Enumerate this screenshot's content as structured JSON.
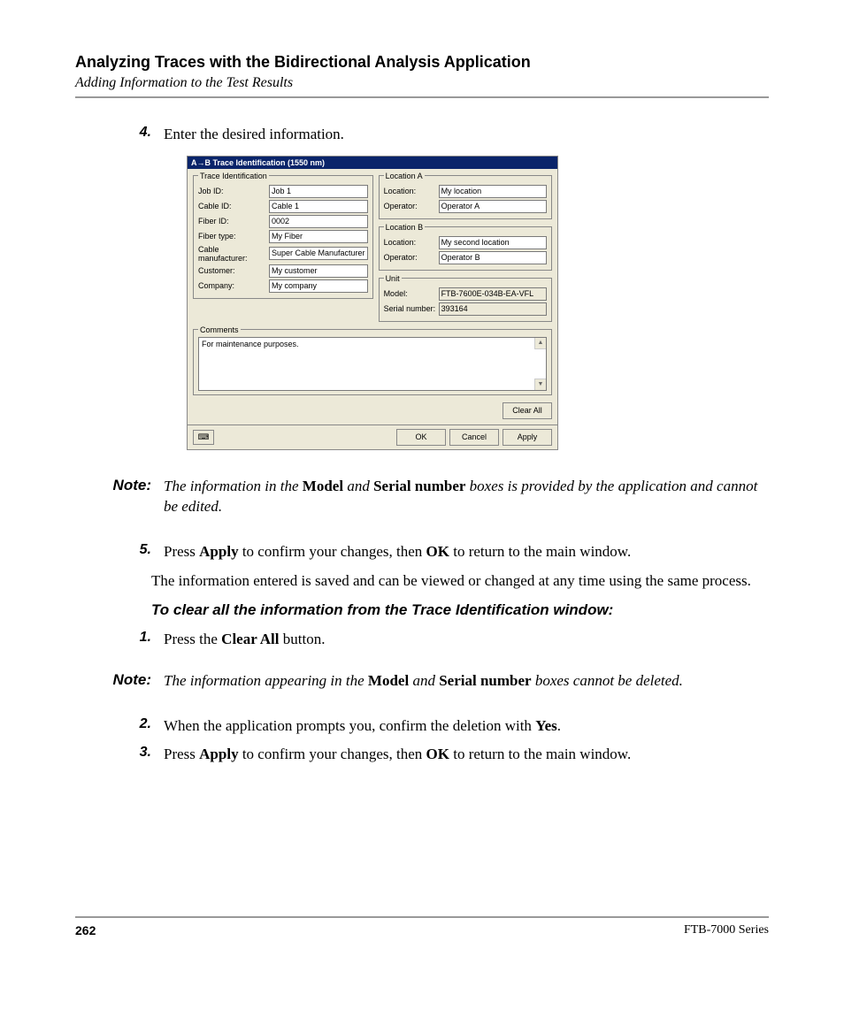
{
  "header": {
    "chapter_title": "Analyzing Traces with the Bidirectional Analysis Application",
    "chapter_sub": "Adding Information to the Test Results"
  },
  "step4": {
    "num": "4.",
    "text": "Enter the desired information."
  },
  "dialog": {
    "title": "A→B Trace Identification (1550 nm)",
    "trace_id": {
      "legend": "Trace Identification",
      "job_id_l": "Job ID:",
      "job_id": "Job 1",
      "cable_id_l": "Cable ID:",
      "cable_id": "Cable 1",
      "fiber_id_l": "Fiber ID:",
      "fiber_id": "0002",
      "fiber_type_l": "Fiber type:",
      "fiber_type": "My Fiber",
      "cable_mfr_l": "Cable manufacturer:",
      "cable_mfr": "Super Cable Manufacturer",
      "customer_l": "Customer:",
      "customer": "My customer",
      "company_l": "Company:",
      "company": "My company"
    },
    "loc_a": {
      "legend": "Location A",
      "loc_l": "Location:",
      "loc": "My location",
      "op_l": "Operator:",
      "op": "Operator A"
    },
    "loc_b": {
      "legend": "Location B",
      "loc_l": "Location:",
      "loc": "My second location",
      "op_l": "Operator:",
      "op": "Operator B"
    },
    "unit": {
      "legend": "Unit",
      "model_l": "Model:",
      "model": "FTB-7600E-034B-EA-VFL",
      "sn_l": "Serial number:",
      "sn": "393164"
    },
    "comments": {
      "legend": "Comments",
      "text": "For maintenance purposes."
    },
    "buttons": {
      "clear_all": "Clear All",
      "ok": "OK",
      "cancel": "Cancel",
      "apply": "Apply"
    }
  },
  "note1_label": "Note:",
  "note1_a": "The information in the ",
  "note1_b": "Model",
  "note1_c": " and ",
  "note1_d": "Serial number",
  "note1_e": " boxes is provided by the application and cannot be edited.",
  "step5": {
    "num": "5.",
    "a": "Press ",
    "b": "Apply",
    "c": " to confirm your changes, then ",
    "d": "OK",
    "e": " to return to the main window."
  },
  "para_saved": "The information entered is saved and can be viewed or changed at any time using the same process.",
  "subhead": "To clear all the information from the Trace Identification window:",
  "c1": {
    "num": "1.",
    "a": "Press the ",
    "b": "Clear All",
    "c": " button."
  },
  "note2_label": "Note:",
  "note2_a": "The information appearing in the ",
  "note2_b": "Model",
  "note2_c": " and ",
  "note2_d": "Serial number",
  "note2_e": " boxes cannot be deleted.",
  "c2": {
    "num": "2.",
    "a": "When the application prompts you, confirm the deletion with ",
    "b": "Yes",
    "c": "."
  },
  "c3": {
    "num": "3.",
    "a": "Press ",
    "b": "Apply",
    "c": " to confirm your changes, then ",
    "d": "OK",
    "e": " to return to the main window."
  },
  "footer": {
    "page": "262",
    "series": "FTB-7000 Series"
  }
}
